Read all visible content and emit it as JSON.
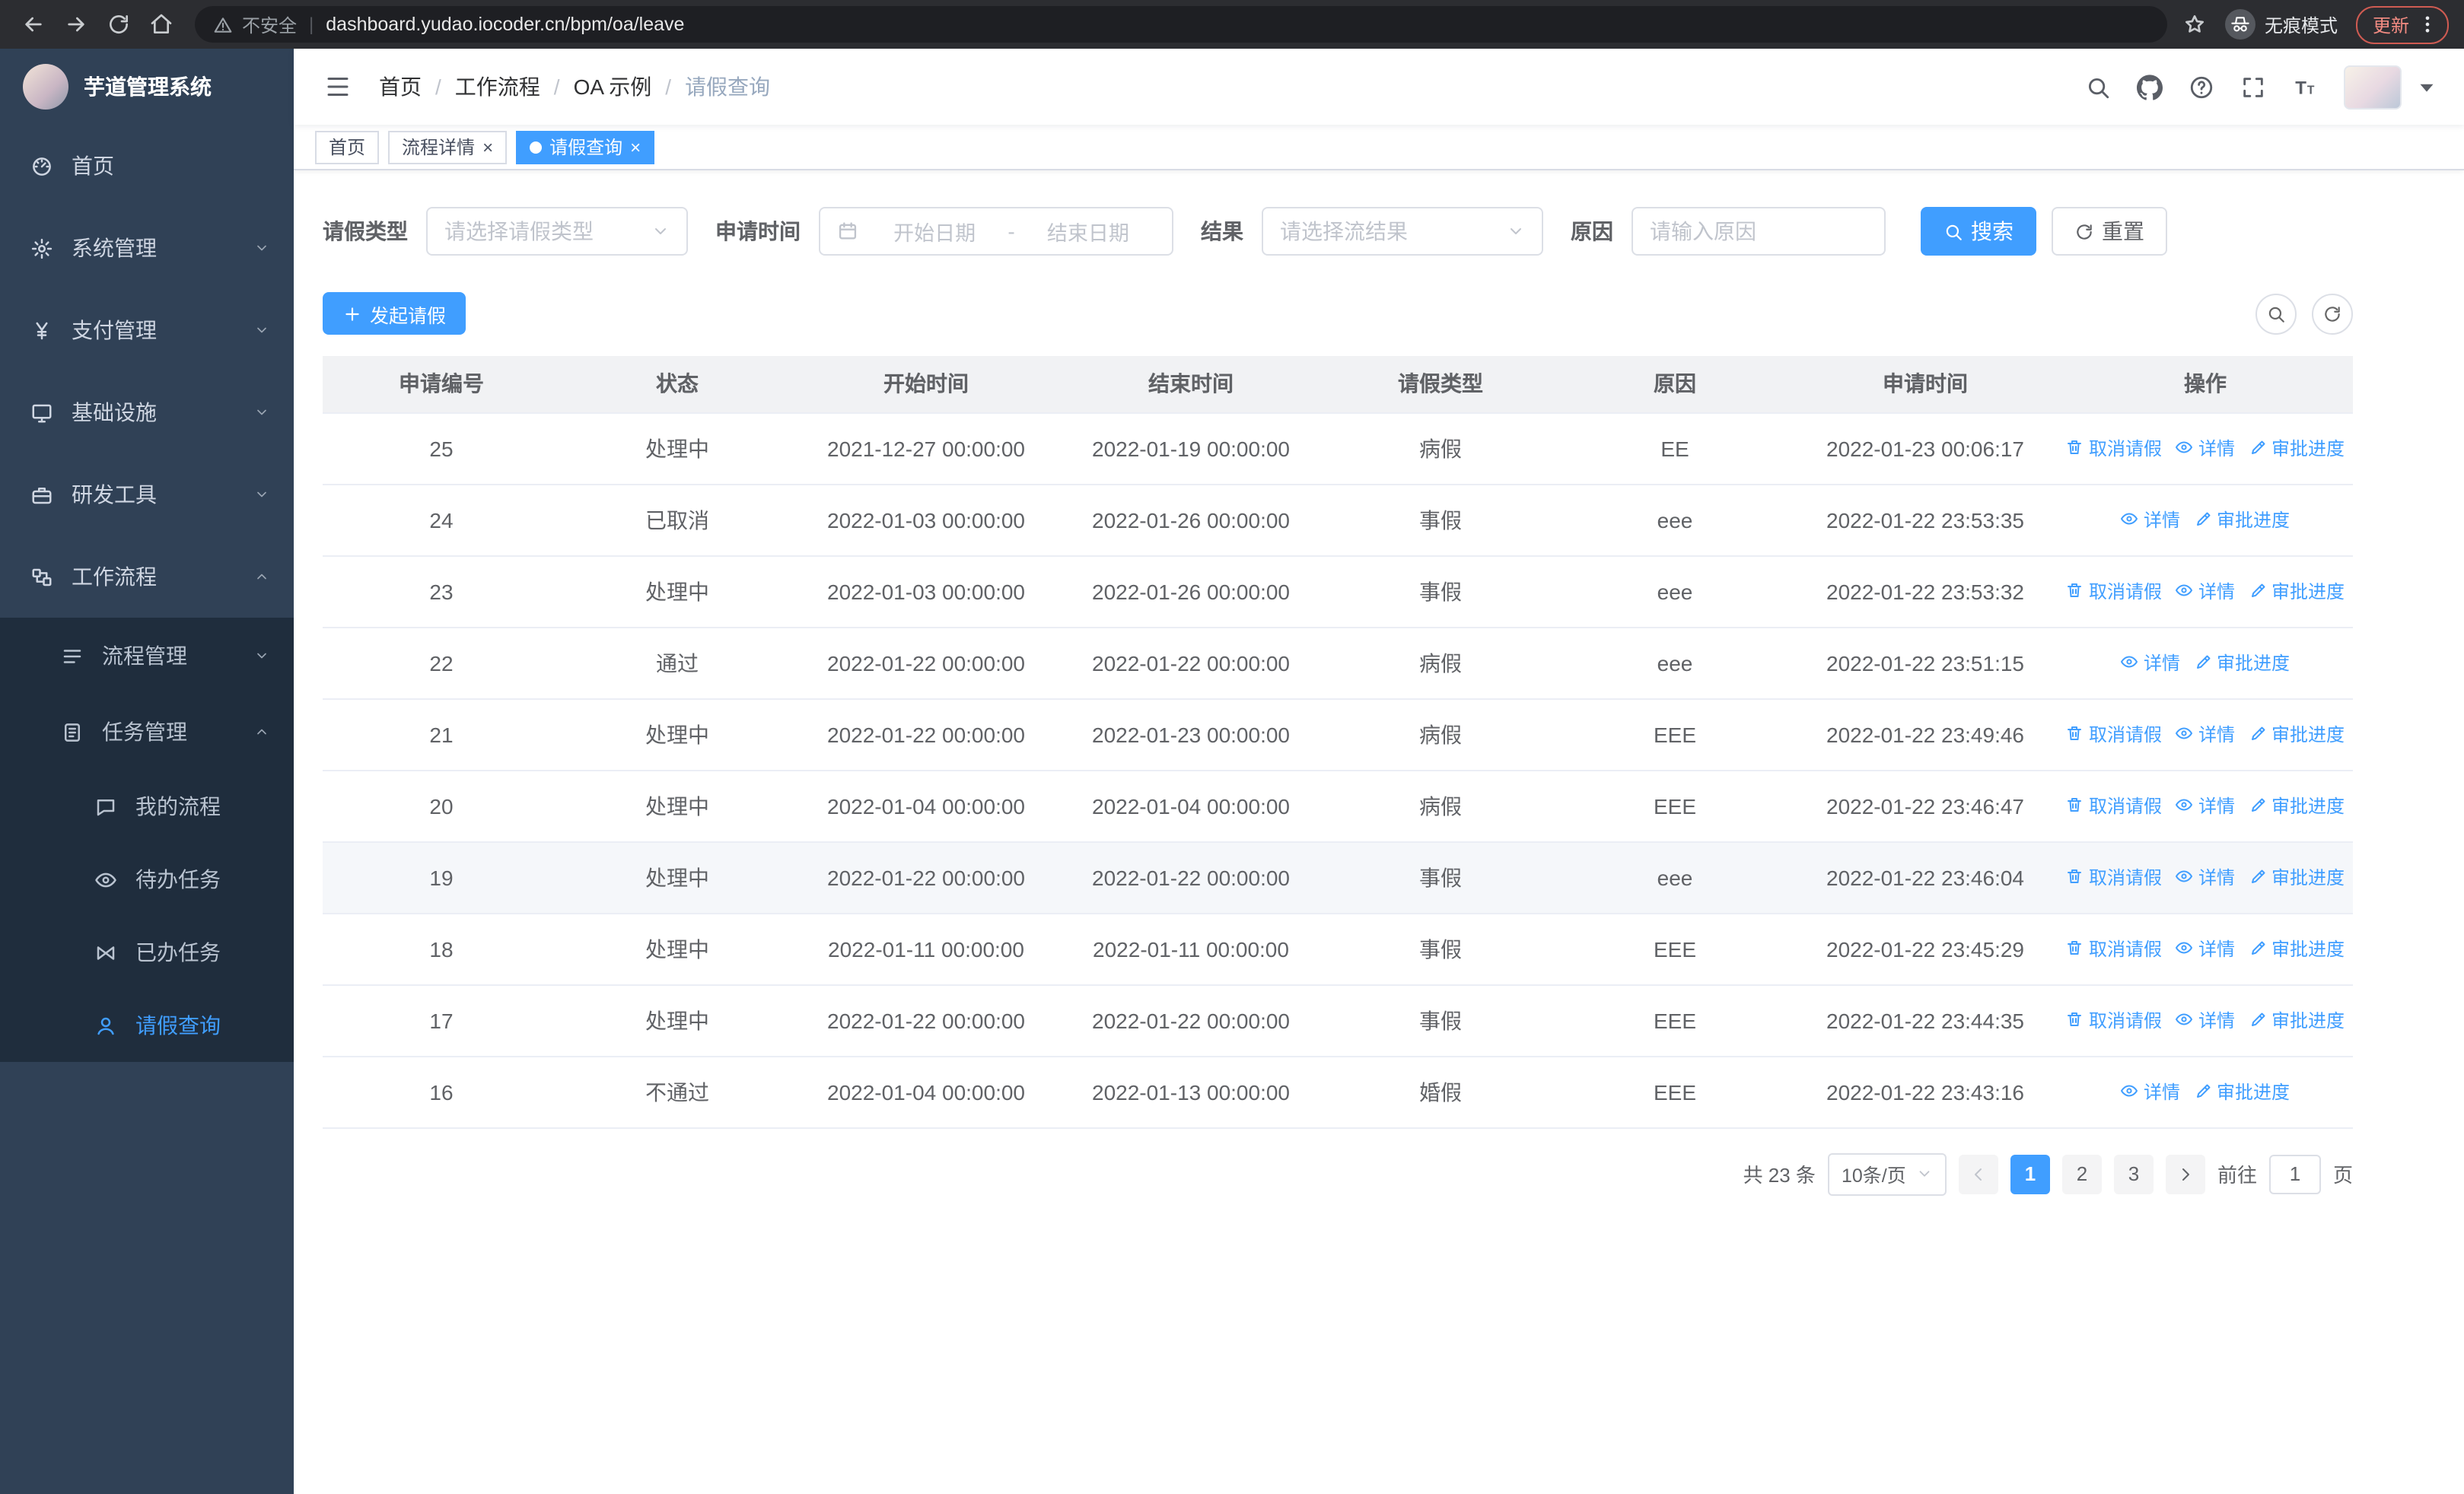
{
  "browser": {
    "security_label": "不安全",
    "url": "dashboard.yudao.iocoder.cn/bpm/oa/leave",
    "incognito_label": "无痕模式",
    "update_label": "更新"
  },
  "sidebar": {
    "logo_title": "芋道管理系统",
    "menu": [
      {
        "name": "home",
        "label": "首页",
        "icon": "dashboard-icon",
        "level": 1
      },
      {
        "name": "system",
        "label": "系统管理",
        "icon": "gear-icon",
        "level": 1,
        "arrow": "down"
      },
      {
        "name": "payment",
        "label": "支付管理",
        "icon": "yen-icon",
        "level": 1,
        "arrow": "down"
      },
      {
        "name": "infrastructure",
        "label": "基础设施",
        "icon": "infra-icon",
        "level": 1,
        "arrow": "down"
      },
      {
        "name": "dev-tools",
        "label": "研发工具",
        "icon": "tools-icon",
        "level": 1,
        "arrow": "down"
      },
      {
        "name": "workflow",
        "label": "工作流程",
        "icon": "workflow-icon",
        "level": 1,
        "arrow": "up"
      },
      {
        "name": "process-management",
        "label": "流程管理",
        "icon": "process-icon",
        "level": 2,
        "arrow": "down",
        "sub": true
      },
      {
        "name": "task-management",
        "label": "任务管理",
        "icon": "task-icon",
        "level": 2,
        "arrow": "up",
        "sub": true
      },
      {
        "name": "my-process",
        "label": "我的流程",
        "icon": "chat-icon",
        "level": 3,
        "sub": true
      },
      {
        "name": "todo-tasks",
        "label": "待办任务",
        "icon": "eye-icon",
        "level": 3,
        "sub": true
      },
      {
        "name": "done-tasks",
        "label": "已办任务",
        "icon": "done-icon",
        "level": 3,
        "sub": true
      },
      {
        "name": "leave-query",
        "label": "请假查询",
        "icon": "user-icon",
        "level": 3,
        "sub": true,
        "active": true
      }
    ]
  },
  "breadcrumb": {
    "items": [
      "首页",
      "工作流程",
      "OA 示例",
      "请假查询"
    ]
  },
  "tabs": [
    {
      "name": "home",
      "label": "首页",
      "closable": false,
      "active": false
    },
    {
      "name": "process-detail",
      "label": "流程详情",
      "closable": true,
      "active": false
    },
    {
      "name": "leave-query",
      "label": "请假查询",
      "closable": true,
      "active": true
    }
  ],
  "filters": {
    "leave_type_label": "请假类型",
    "leave_type_placeholder": "请选择请假类型",
    "apply_time_label": "申请时间",
    "date_start_placeholder": "开始日期",
    "date_separator": "-",
    "date_end_placeholder": "结束日期",
    "result_label": "结果",
    "result_placeholder": "请选择流结果",
    "reason_label": "原因",
    "reason_placeholder": "请输入原因",
    "search_label": "搜索",
    "reset_label": "重置"
  },
  "toolbar": {
    "create_label": "发起请假"
  },
  "table": {
    "columns": [
      "申请编号",
      "状态",
      "开始时间",
      "结束时间",
      "请假类型",
      "原因",
      "申请时间",
      "操作"
    ],
    "action_labels": {
      "cancel": "取消请假",
      "detail": "详情",
      "progress": "审批进度"
    },
    "rows": [
      {
        "id": "25",
        "status": "处理中",
        "start": "2021-12-27 00:00:00",
        "end": "2022-01-19 00:00:00",
        "type": "病假",
        "reason": "EE",
        "applied": "2022-01-23 00:06:17",
        "actions": [
          "cancel",
          "detail",
          "progress"
        ]
      },
      {
        "id": "24",
        "status": "已取消",
        "start": "2022-01-03 00:00:00",
        "end": "2022-01-26 00:00:00",
        "type": "事假",
        "reason": "eee",
        "applied": "2022-01-22 23:53:35",
        "actions": [
          "detail",
          "progress"
        ]
      },
      {
        "id": "23",
        "status": "处理中",
        "start": "2022-01-03 00:00:00",
        "end": "2022-01-26 00:00:00",
        "type": "事假",
        "reason": "eee",
        "applied": "2022-01-22 23:53:32",
        "actions": [
          "cancel",
          "detail",
          "progress"
        ]
      },
      {
        "id": "22",
        "status": "通过",
        "start": "2022-01-22 00:00:00",
        "end": "2022-01-22 00:00:00",
        "type": "病假",
        "reason": "eee",
        "applied": "2022-01-22 23:51:15",
        "actions": [
          "detail",
          "progress"
        ]
      },
      {
        "id": "21",
        "status": "处理中",
        "start": "2022-01-22 00:00:00",
        "end": "2022-01-23 00:00:00",
        "type": "病假",
        "reason": "EEE",
        "applied": "2022-01-22 23:49:46",
        "actions": [
          "cancel",
          "detail",
          "progress"
        ]
      },
      {
        "id": "20",
        "status": "处理中",
        "start": "2022-01-04 00:00:00",
        "end": "2022-01-04 00:00:00",
        "type": "病假",
        "reason": "EEE",
        "applied": "2022-01-22 23:46:47",
        "actions": [
          "cancel",
          "detail",
          "progress"
        ]
      },
      {
        "id": "19",
        "status": "处理中",
        "start": "2022-01-22 00:00:00",
        "end": "2022-01-22 00:00:00",
        "type": "事假",
        "reason": "eee",
        "applied": "2022-01-22 23:46:04",
        "actions": [
          "cancel",
          "detail",
          "progress"
        ],
        "highlight": true
      },
      {
        "id": "18",
        "status": "处理中",
        "start": "2022-01-11 00:00:00",
        "end": "2022-01-11 00:00:00",
        "type": "事假",
        "reason": "EEE",
        "applied": "2022-01-22 23:45:29",
        "actions": [
          "cancel",
          "detail",
          "progress"
        ]
      },
      {
        "id": "17",
        "status": "处理中",
        "start": "2022-01-22 00:00:00",
        "end": "2022-01-22 00:00:00",
        "type": "事假",
        "reason": "EEE",
        "applied": "2022-01-22 23:44:35",
        "actions": [
          "cancel",
          "detail",
          "progress"
        ]
      },
      {
        "id": "16",
        "status": "不通过",
        "start": "2022-01-04 00:00:00",
        "end": "2022-01-13 00:00:00",
        "type": "婚假",
        "reason": "EEE",
        "applied": "2022-01-22 23:43:16",
        "actions": [
          "detail",
          "progress"
        ]
      }
    ]
  },
  "pagination": {
    "total_text": "共 23 条",
    "page_size": "10条/页",
    "pages": [
      "1",
      "2",
      "3"
    ],
    "active_page": "1",
    "goto_prefix": "前往",
    "goto_value": "1",
    "goto_suffix": "页"
  },
  "colors": {
    "primary": "#409eff",
    "sidebar_bg": "#304156",
    "sidebar_sub_bg": "#1f2d3d",
    "table_header_bg": "#f1f2f4"
  }
}
